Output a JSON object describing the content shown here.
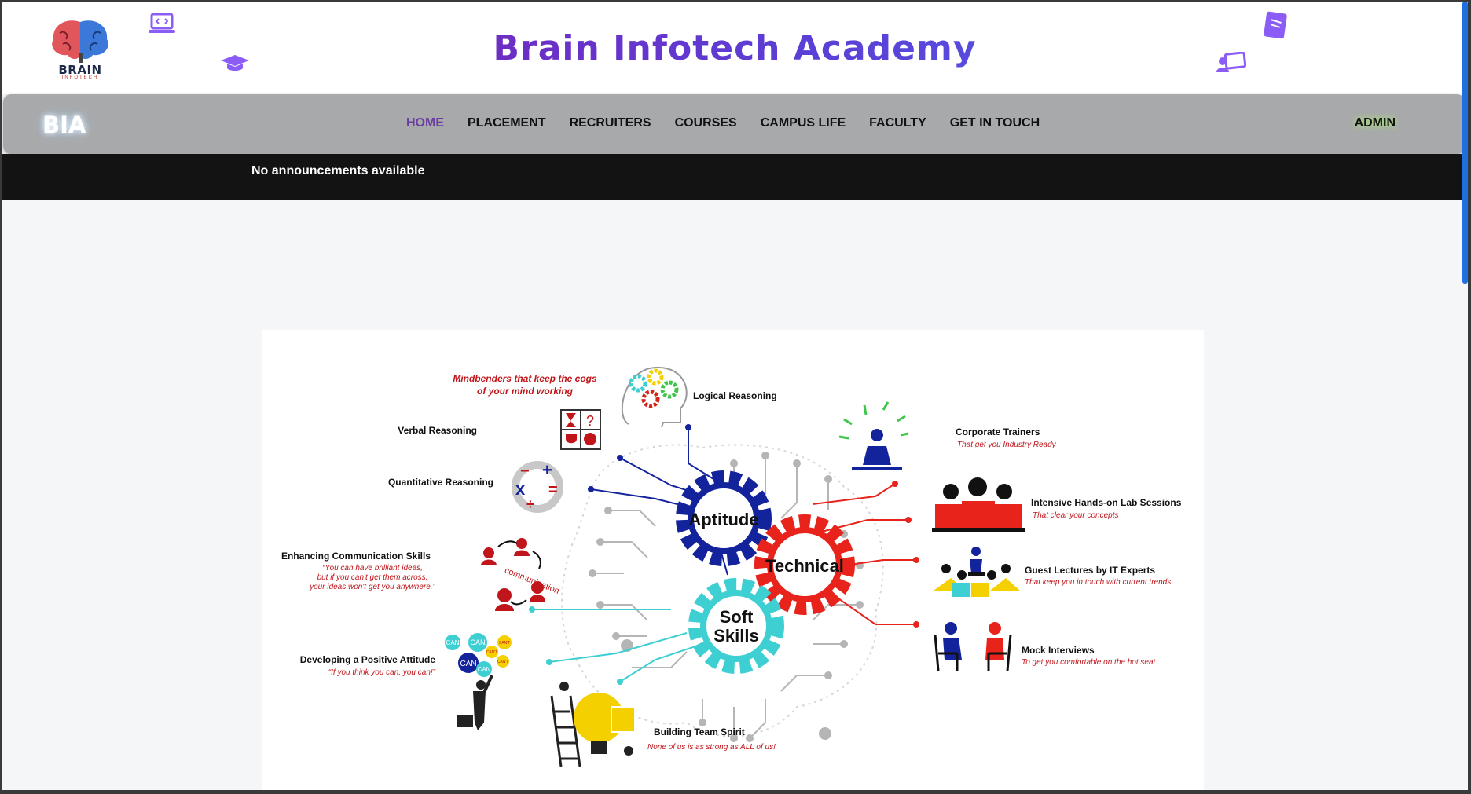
{
  "header": {
    "title": "Brain Infotech Academy",
    "logo_text": "BRAIN",
    "logo_sub": "INFOTECH",
    "decor_icons": [
      "laptop-code-icon",
      "graduation-cap-icon",
      "book-icon",
      "chalkboard-teacher-icon"
    ]
  },
  "navbar": {
    "brand": "BIA",
    "links": [
      {
        "label": "HOME",
        "active": true
      },
      {
        "label": "PLACEMENT",
        "active": false
      },
      {
        "label": "RECRUITERS",
        "active": false
      },
      {
        "label": "COURSES",
        "active": false
      },
      {
        "label": "CAMPUS LIFE",
        "active": false
      },
      {
        "label": "FACULTY",
        "active": false
      },
      {
        "label": "GET IN TOUCH",
        "active": false
      }
    ],
    "admin": "ADMIN"
  },
  "announcement": {
    "text": "No announcements available"
  },
  "infographic": {
    "gears": {
      "aptitude": "Aptitude",
      "technical": "Technical",
      "soft_line1": "Soft",
      "soft_line2": "Skills"
    },
    "left": {
      "mindbenders_line1": "Mindbenders that keep the cogs",
      "mindbenders_line2": "of your mind working",
      "logical": "Logical Reasoning",
      "verbal": "Verbal Reasoning",
      "quant": "Quantitative Reasoning",
      "comm_title": "Enhancing Communication Skills",
      "comm_q1": "“You can have brilliant ideas,",
      "comm_q2": "but if you can't get them across,",
      "comm_q3": "your ideas won't get you anywhere.”",
      "comm_word": "communication",
      "attitude_title": "Developing a Positive Attitude",
      "attitude_quote": "“If you think you can, you can!”",
      "can": "CAN",
      "cant": "CAN'T",
      "team_title": "Building Team Spirit",
      "team_quote": "None of us is as strong as ALL of us!"
    },
    "right": {
      "trainers_title": "Corporate Trainers",
      "trainers_sub": "That get you Industry Ready",
      "lab_title": "Intensive Hands-on Lab Sessions",
      "lab_sub": "That clear your concepts",
      "guest_title": "Guest Lectures by IT Experts",
      "guest_sub": "That keep you in touch with current trends",
      "mock_title": "Mock Interviews",
      "mock_sub": "To get you comfortable on the hot seat"
    },
    "colors": {
      "aptitude": "#13239b",
      "technical": "#e8231c",
      "soft": "#3ecfd3",
      "circuit": "#b5b5b5",
      "accent_red": "#c0161b"
    }
  }
}
